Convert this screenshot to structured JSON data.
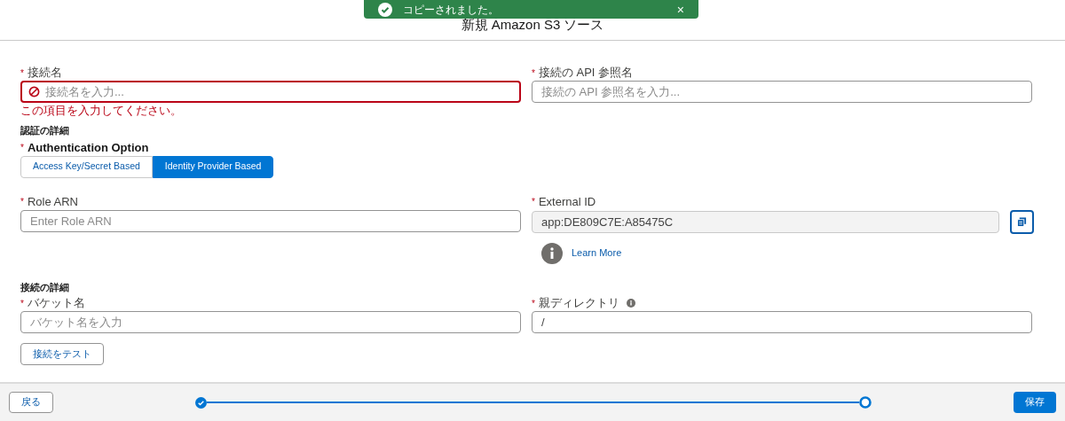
{
  "toast": {
    "message": "コピーされました。",
    "close": "×"
  },
  "header": {
    "title": "新規 Amazon S3 ソース"
  },
  "fields_top": [
    {
      "label": "接続名",
      "required": "*",
      "placeholder": "接続名を入力...",
      "error": "この項目を入力してください。"
    },
    {
      "label": "接続の API 参照名",
      "required": "*",
      "placeholder": "接続の API 参照名を入力..."
    }
  ],
  "auth_section": {
    "heading": "認証の詳細",
    "option_label": "Authentication Option",
    "required": "*",
    "options": [
      {
        "label": "Access Key/Secret Based",
        "selected": false
      },
      {
        "label": "Identity Provider Based",
        "selected": true
      }
    ]
  },
  "role_arn": {
    "label": "Role ARN",
    "required": "*",
    "placeholder": "Enter Role ARN"
  },
  "external_id": {
    "label": "External ID",
    "required": "*",
    "value": "app:DE809C7E:A85475C",
    "disabled": true,
    "learn_more": "Learn More"
  },
  "connection_section": {
    "heading": "接続の詳細",
    "fields": [
      {
        "label": "バケット名",
        "required": "*",
        "placeholder": "バケット名を入力",
        "info": false
      },
      {
        "label": "親ディレクトリ",
        "required": "*",
        "value": "/",
        "info": true
      }
    ],
    "test_button": "接続をテスト"
  },
  "footer": {
    "back": "戻る",
    "save": "保存",
    "steps": [
      {
        "completed": true
      },
      {
        "completed": false
      }
    ]
  }
}
